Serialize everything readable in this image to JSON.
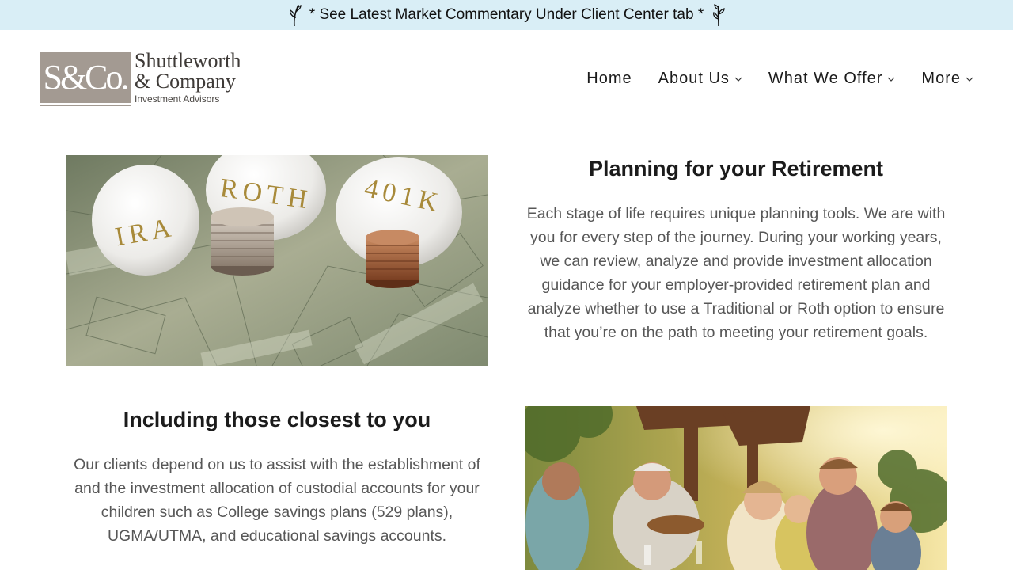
{
  "announcement": {
    "text": "* See Latest Market Commentary Under Client Center tab *"
  },
  "logo": {
    "monogram": "S&Co.",
    "name_line1": "Shuttleworth",
    "name_line2": "& Company",
    "tagline": "Investment Advisors"
  },
  "nav": {
    "items": [
      {
        "label": "Home",
        "has_dropdown": false
      },
      {
        "label": "About Us",
        "has_dropdown": true
      },
      {
        "label": "What We Offer",
        "has_dropdown": true
      },
      {
        "label": "More",
        "has_dropdown": true
      }
    ]
  },
  "sections": [
    {
      "title": "Planning for your Retirement",
      "body": "Each stage of life requires unique planning tools. We are with you for every step of the journey.  During your working years, we can review, analyze and provide investment allocation guidance for your employer-provided retirement plan and analyze whether to use a Traditional or Roth option to ensure that you’re on the path to meeting your retirement goals.",
      "image": {
        "egg_labels": [
          "IRA",
          "ROTH",
          "401K"
        ]
      }
    },
    {
      "title": "Including those closest to you",
      "body": "Our clients depend on us to assist with the establishment of and the investment allocation of custodial accounts for your children such as College savings plans (529 plans), UGMA/UTMA, and educational savings accounts."
    }
  ],
  "colors": {
    "announcement_bg": "#d9eef6",
    "logo_gray": "#a39a92",
    "body_text": "#575757",
    "heading_text": "#1b1b1b"
  }
}
